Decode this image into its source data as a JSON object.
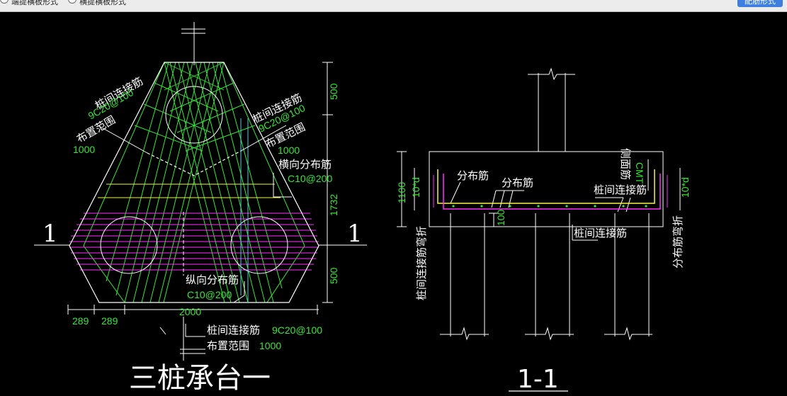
{
  "toolbar": {
    "option1_label": "端提横板形式",
    "option2_label": "横提横板形式",
    "apply_label": "配筋形式"
  },
  "plan": {
    "title": "三桩承台一",
    "section_mark": "1",
    "left_tie": {
      "label": "桩间连接筋",
      "spec": "9C20@100",
      "range_label": "布置范围",
      "range": "1000"
    },
    "right_tie": {
      "label": "桩间连接筋",
      "spec": "9C20@100",
      "range_label": "布置范围",
      "range": "1000"
    },
    "transverse": {
      "label": "横向分布筋",
      "spec": "C10@200"
    },
    "longitudinal": {
      "label": "纵向分布筋",
      "spec": "C10@200"
    },
    "bottom_tie": {
      "label": "桩间连接筋",
      "spec": "9C20@100",
      "range_label": "布置范围",
      "range": "1000"
    },
    "dims": {
      "top": "500",
      "middle": "1732",
      "bottom": "500",
      "width": "2000",
      "left1": "289",
      "left2": "289"
    }
  },
  "section": {
    "title": "1-1",
    "dist_bar_1": "分布筋",
    "dist_bar_2": "分布筋",
    "side_bar": "侧面筋",
    "side_spec": "CMT",
    "tie_bar": "桩间连接筋",
    "tie_bar_2": "桩间连接筋",
    "height": "1100",
    "anchor": "10*d",
    "anchor_right": "10*d",
    "cover": "100",
    "left_note": "桩间连接筋弯折",
    "right_note": "分布筋弯折"
  },
  "colors": {
    "background": "#000000",
    "line": "#ffffff",
    "rebar_green": "#37e637",
    "hatch_magenta": "#ff2dff",
    "yellow": "#f5f542",
    "cyan": "#39d9e8"
  }
}
